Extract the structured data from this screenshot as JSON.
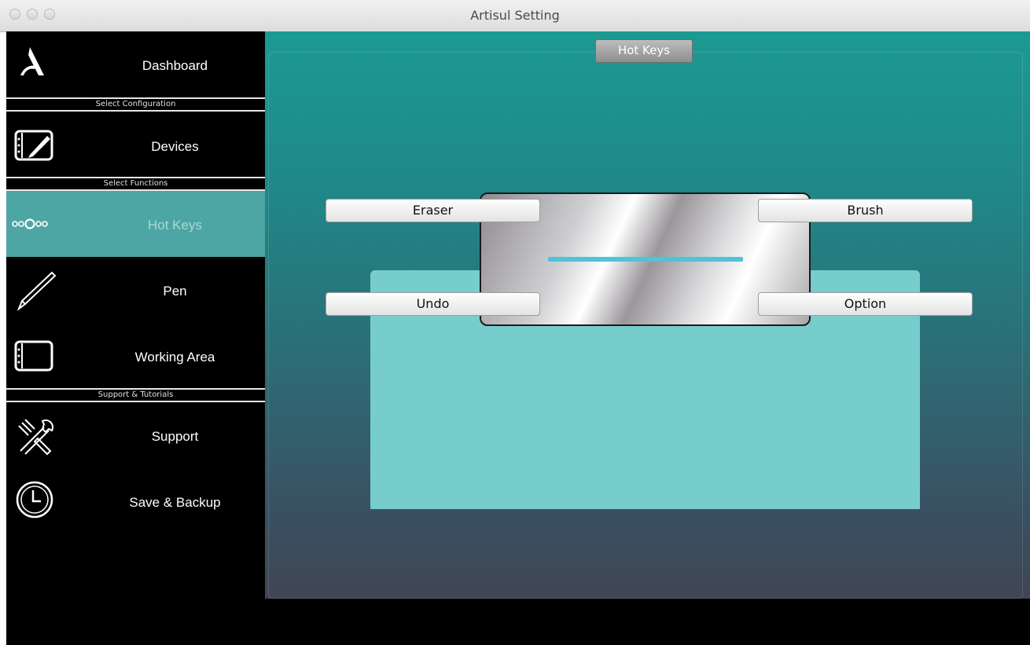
{
  "window": {
    "title": "Artisul Setting"
  },
  "sidebar": {
    "dashboard": "Dashboard",
    "sections": {
      "config": "Select Configuration",
      "functions": "Select Functions",
      "support": "Support & Tutorials"
    },
    "items": [
      {
        "label": "Devices",
        "icon": "tablet-pen-icon"
      },
      {
        "label": "Hot Keys",
        "icon": "hotkeys-dots-icon",
        "active": true
      },
      {
        "label": "Pen",
        "icon": "pen-icon"
      },
      {
        "label": "Working Area",
        "icon": "tablet-area-icon"
      },
      {
        "label": "Support",
        "icon": "tools-icon"
      },
      {
        "label": "Save & Backup",
        "icon": "clock-icon"
      }
    ]
  },
  "main": {
    "tab": "Hot Keys",
    "keys": {
      "top_left": "Eraser",
      "top_right": "Brush",
      "bottom_left": "Undo",
      "bottom_right": "Option"
    }
  },
  "colors": {
    "active_item": "#4ea6a4",
    "panel": "#77cccc",
    "accent_bar": "#4fc3d8"
  }
}
